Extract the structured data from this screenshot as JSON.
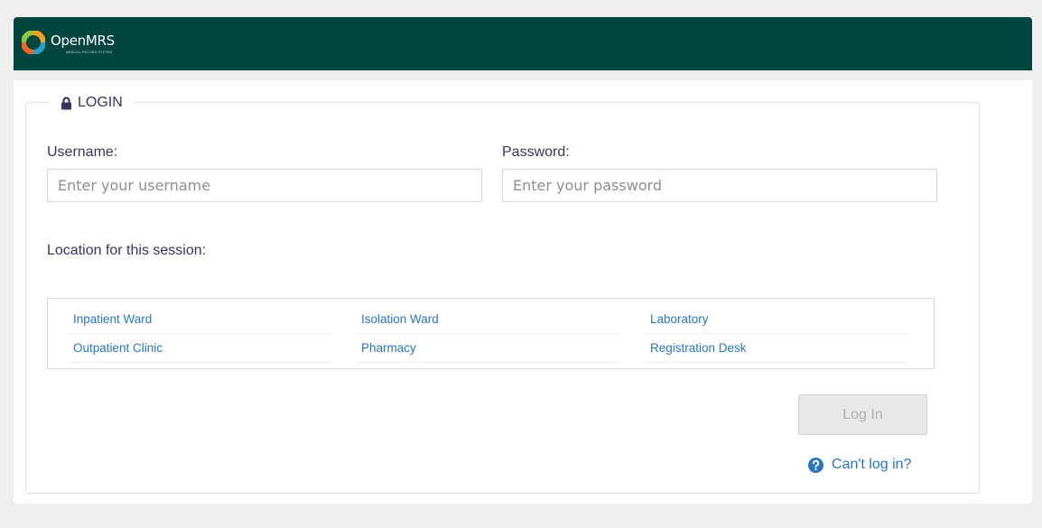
{
  "brand": {
    "name": "OpenMRS",
    "tagline": "MEDICAL RECORD SYSTEM",
    "header_color": "#00463f"
  },
  "login": {
    "legend": "LOGIN",
    "legend_icon": "lock-icon",
    "username_label": "Username:",
    "username_placeholder": "Enter your username",
    "username_value": "",
    "password_label": "Password:",
    "password_placeholder": "Enter your password",
    "password_value": "",
    "location_label": "Location for this session:",
    "locations": [
      "Inpatient Ward",
      "Isolation Ward",
      "Laboratory",
      "Outpatient Clinic",
      "Pharmacy",
      "Registration Desk"
    ],
    "login_button": "Log In",
    "help_icon": "question-circle-icon",
    "help_link": "Can't log in?",
    "link_color": "#2a76c6"
  }
}
